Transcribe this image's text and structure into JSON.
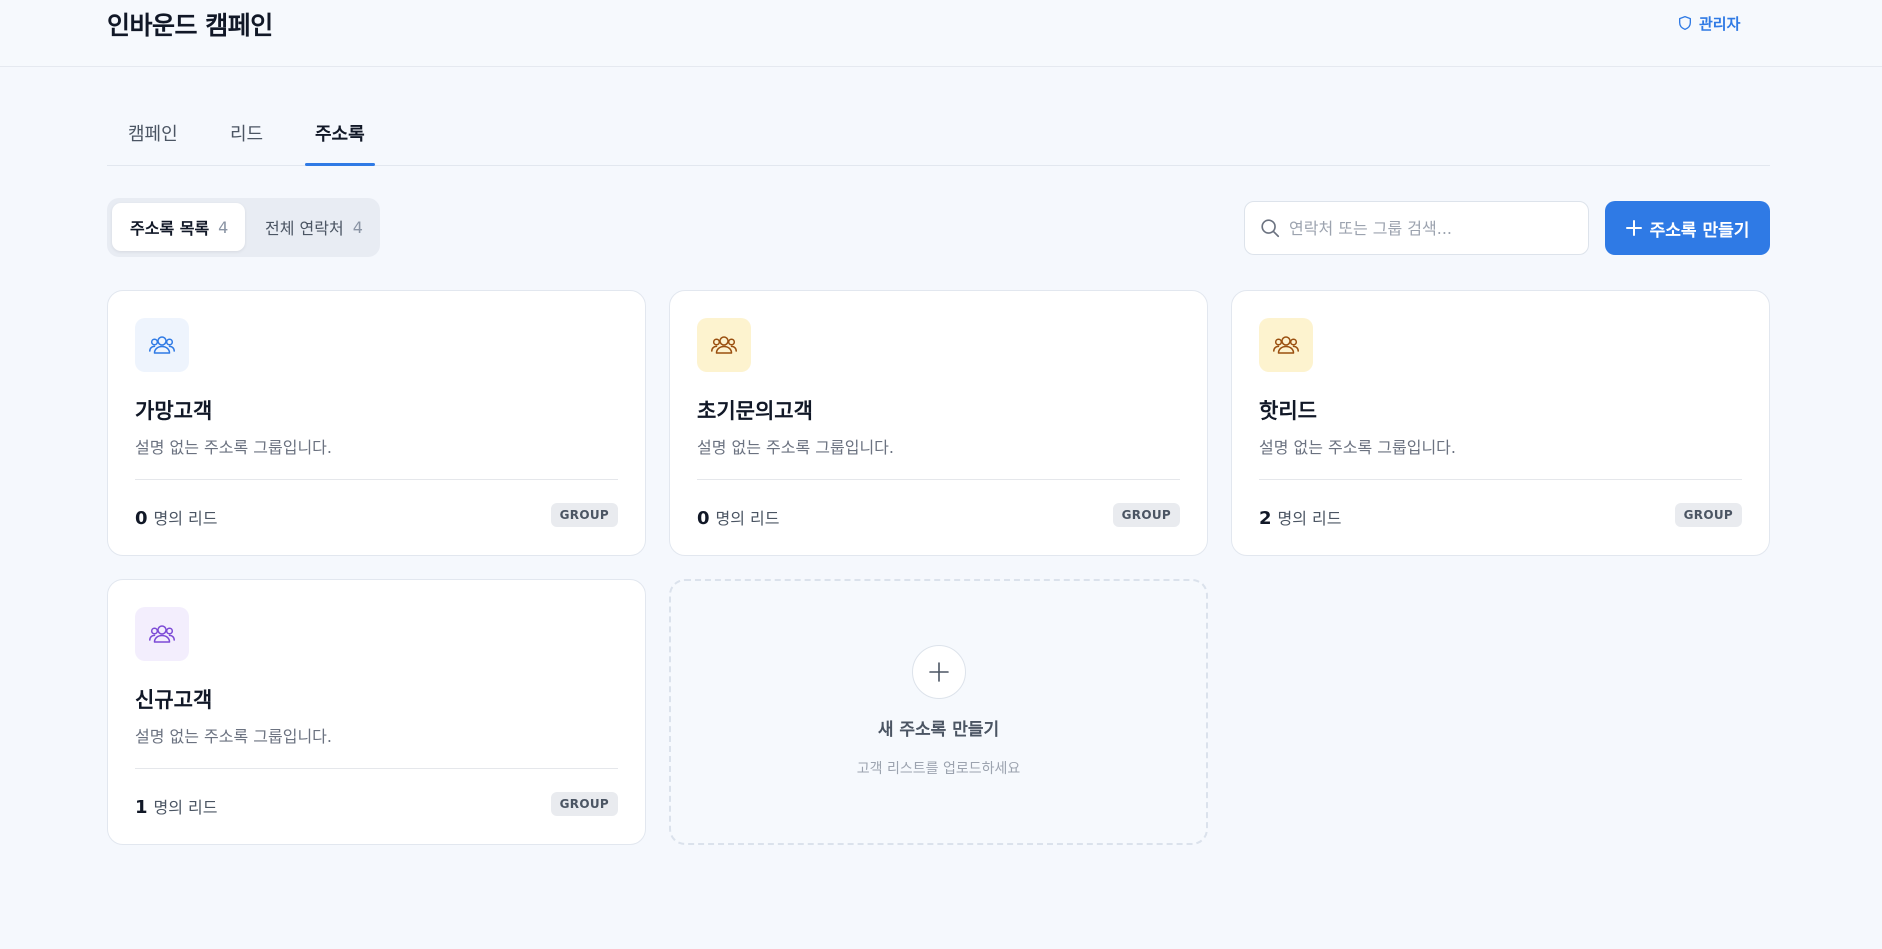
{
  "header": {
    "title": "인바운드 캠페인",
    "admin_label": "관리자"
  },
  "tabs": [
    {
      "label": "캠페인",
      "active": false
    },
    {
      "label": "리드",
      "active": false
    },
    {
      "label": "주소록",
      "active": true
    }
  ],
  "segment": {
    "list_label": "주소록 목록",
    "list_count": "4",
    "contacts_label": "전체 연락처",
    "contacts_count": "4"
  },
  "search": {
    "placeholder": "연락처 또는 그룹 검색..."
  },
  "create_button": {
    "label": "주소록 만들기"
  },
  "colors": {
    "accent": "#2f7ae5",
    "icon_blue_bg": "#eef4fd",
    "icon_blue": "#2f7ae5",
    "icon_amber_bg": "#fdf3cf",
    "icon_amber": "#9a4f0f",
    "icon_purple_bg": "#f3eefd",
    "icon_purple": "#7c4ad6"
  },
  "groups": [
    {
      "name": "가망고객",
      "description": "설명 없는 주소록 그룹입니다.",
      "count": "0",
      "count_suffix": "명의 리드",
      "badge": "GROUP",
      "icon": "users-icon",
      "color": "blue"
    },
    {
      "name": "초기문의고객",
      "description": "설명 없는 주소록 그룹입니다.",
      "count": "0",
      "count_suffix": "명의 리드",
      "badge": "GROUP",
      "icon": "users-icon",
      "color": "amber"
    },
    {
      "name": "핫리드",
      "description": "설명 없는 주소록 그룹입니다.",
      "count": "2",
      "count_suffix": "명의 리드",
      "badge": "GROUP",
      "icon": "users-icon",
      "color": "amber"
    },
    {
      "name": "신규고객",
      "description": "설명 없는 주소록 그룹입니다.",
      "count": "1",
      "count_suffix": "명의 리드",
      "badge": "GROUP",
      "icon": "users-icon",
      "color": "purple"
    }
  ],
  "new_card": {
    "title": "새 주소록 만들기",
    "subtitle": "고객 리스트를 업로드하세요"
  }
}
